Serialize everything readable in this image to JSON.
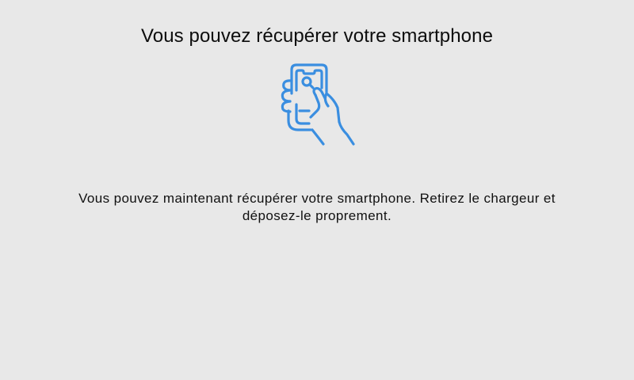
{
  "screen": {
    "title": "Vous pouvez récupérer votre smartphone",
    "illustration_icon": "hand-holding-smartphone-icon",
    "message": "Vous pouvez maintenant récupérer votre smartphone. Retirez le chargeur et déposez-le proprement."
  },
  "colors": {
    "background": "#e8e8e8",
    "accent": "#3a8ee0",
    "text": "#111111"
  }
}
